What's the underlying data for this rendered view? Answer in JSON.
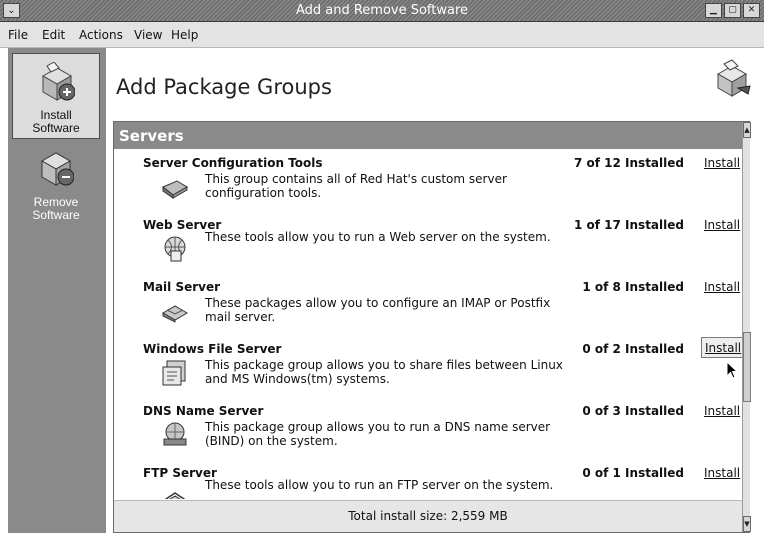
{
  "window": {
    "title": "Add and Remove Software",
    "sysmenu_glyph": "⌄",
    "buttons": [
      "▁",
      "▢",
      "✕"
    ]
  },
  "menu": [
    "File",
    "Edit",
    "Actions",
    "View",
    "Help"
  ],
  "sidebar": {
    "items": [
      {
        "label_line1": "Install",
        "label_line2": "Software",
        "icon": "install-software-icon",
        "active": true
      },
      {
        "label_line1": "Remove",
        "label_line2": "Software",
        "icon": "remove-software-icon",
        "active": false
      }
    ]
  },
  "main": {
    "title": "Add Package Groups",
    "header_icon": "package-manager-icon",
    "section": "Servers",
    "install_label": "Install",
    "groups": [
      {
        "name": "Server Configuration Tools",
        "status": "7 of 12 Installed",
        "desc1": "This group contains all of Red Hat's custom server",
        "desc2": "configuration tools.",
        "icon": "server-config-book-icon"
      },
      {
        "name": "Web Server",
        "status": "1 of 17 Installed",
        "desc1": "These tools allow you to run a Web server on the system.",
        "desc2": "",
        "icon": "web-server-icon"
      },
      {
        "name": "Mail Server",
        "status": "1 of 8 Installed",
        "desc1": "These packages allow you to configure an IMAP or Postfix",
        "desc2": "mail server.",
        "icon": "mail-server-icon"
      },
      {
        "name": "Windows File Server",
        "status": "0 of 2 Installed",
        "desc1": "This package group allows you to share files between Linux",
        "desc2": "and MS Windows(tm) systems.",
        "icon": "windows-file-server-icon"
      },
      {
        "name": "DNS Name Server",
        "status": "0 of 3 Installed",
        "desc1": "This package group allows you to run a DNS name server",
        "desc2": "(BIND) on the system.",
        "icon": "dns-server-icon"
      },
      {
        "name": "FTP Server",
        "status": "0 of 1 Installed",
        "desc1": "These tools allow you to run an FTP server on the system.",
        "desc2": "",
        "icon": "ftp-server-icon"
      }
    ]
  },
  "footer": {
    "total": "Total install size: 2,559 MB"
  },
  "scrollbar": {
    "up": "▲",
    "down": "▼"
  },
  "colors": {
    "sidebar": "#8a8a8a",
    "section_header": "#8a8a8a"
  }
}
